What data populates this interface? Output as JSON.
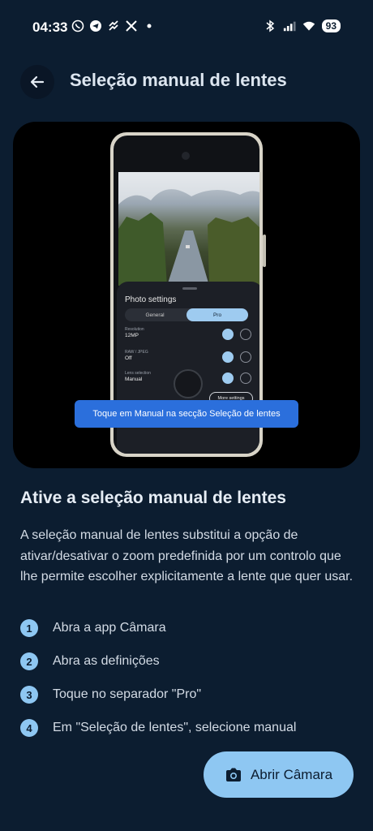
{
  "status_bar": {
    "time": "04:33",
    "battery": "93",
    "left_icons": [
      "whatsapp-icon",
      "telegram-icon",
      "app-icon",
      "x-icon",
      "dot-icon"
    ],
    "right_icons": [
      "bluetooth-icon",
      "signal-icon",
      "wifi-icon"
    ]
  },
  "header": {
    "title": "Seleção manual de lentes",
    "back_icon": "arrow-left-icon"
  },
  "preview": {
    "sheet_title": "Photo settings",
    "tab_general": "General",
    "tab_pro": "Pro",
    "resolution_label": "Resolution",
    "resolution_value": "12MP",
    "raw_label": "RAW / JPEG",
    "raw_value": "Off",
    "lens_label": "Lens selection",
    "lens_value": "Manual",
    "more_settings": "More settings",
    "toast": "Toque em Manual na secção Seleção de lentes"
  },
  "content": {
    "heading": "Ative a seleção manual de lentes",
    "description": "A seleção manual de lentes substitui a opção de ativar/desativar o zoom predefinida por um controlo que lhe permite escolher explicitamente a lente que quer usar.",
    "steps": [
      {
        "num": "1",
        "label": "Abra a app Câmara"
      },
      {
        "num": "2",
        "label": "Abra as definições"
      },
      {
        "num": "3",
        "label": "Toque no separador \"Pro\""
      },
      {
        "num": "4",
        "label": "Em \"Seleção de lentes\", selecione manual"
      }
    ]
  },
  "action_button": {
    "label": "Abrir Câmara",
    "icon": "camera-icon"
  },
  "colors": {
    "background": "#0c1d30",
    "accent": "#8ec7f2",
    "toast": "#2b6fdc"
  }
}
